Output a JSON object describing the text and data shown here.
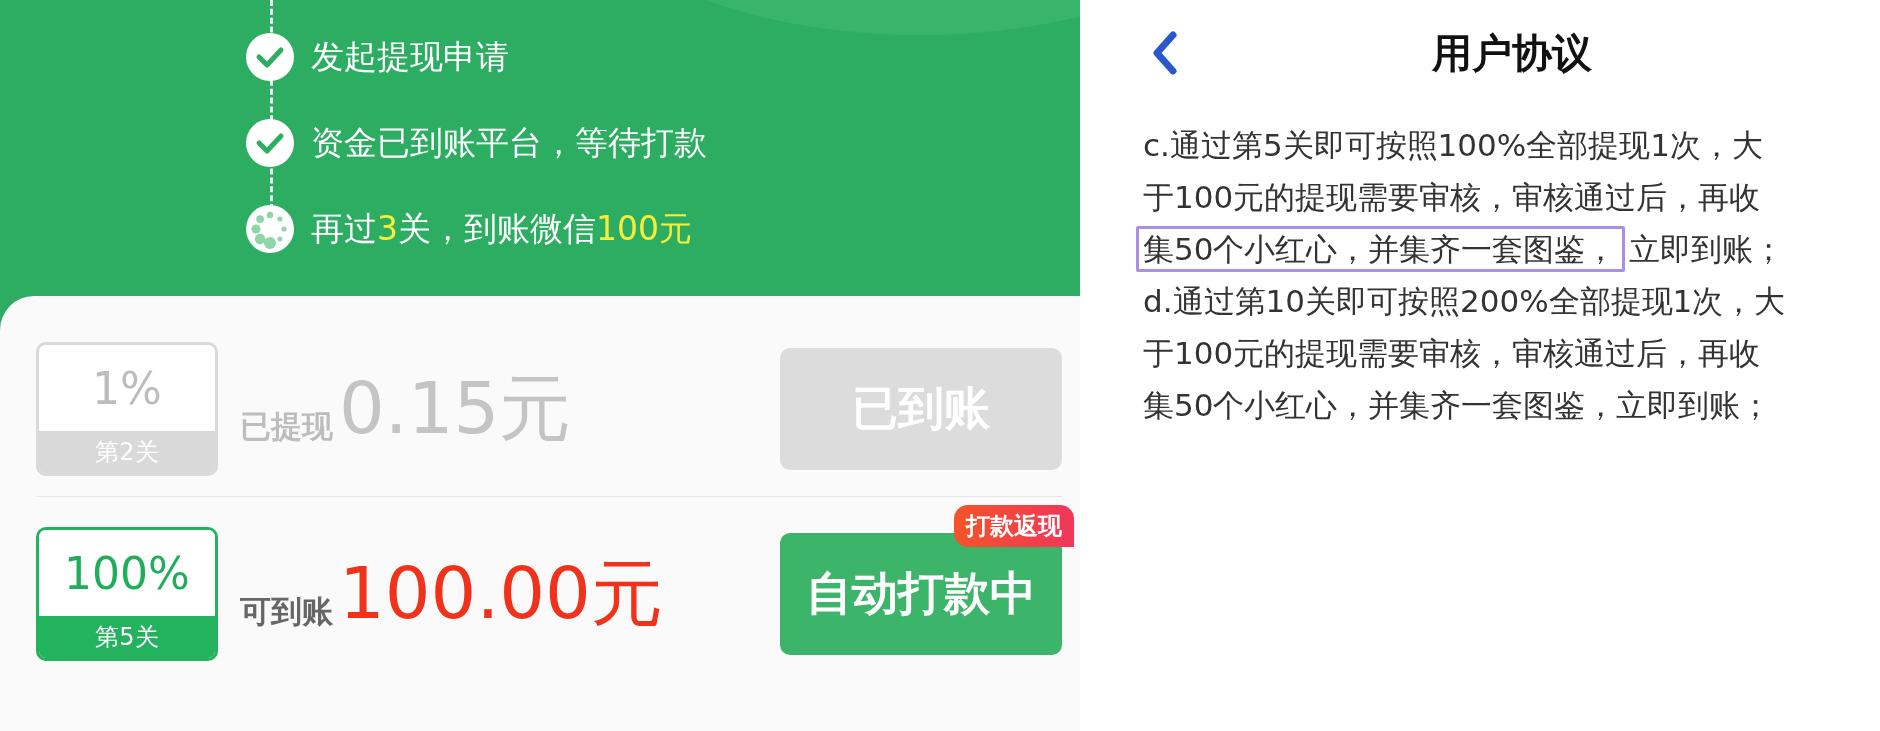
{
  "steps": [
    {
      "kind": "done",
      "segments": [
        {
          "text": "发起提现申请",
          "highlight": false
        }
      ]
    },
    {
      "kind": "done",
      "segments": [
        {
          "text": "资金已到账平台，等待打款",
          "highlight": false
        }
      ]
    },
    {
      "kind": "pending",
      "segments": [
        {
          "text": "再过",
          "highlight": false
        },
        {
          "text": "3",
          "highlight": true
        },
        {
          "text": "关，到账微信",
          "highlight": false
        },
        {
          "text": "100元",
          "highlight": true
        }
      ]
    }
  ],
  "rows": [
    {
      "kind": "withdrawn",
      "percent": "1%",
      "level_label": "第2关",
      "label": "已提现",
      "amount": "0.15元",
      "button": "已到账"
    },
    {
      "kind": "available",
      "percent": "100%",
      "level_label": "第5关",
      "label": "可到账",
      "amount": "100.00元",
      "button": "自动打款中",
      "tag": "打款返现"
    }
  ],
  "agreement": {
    "title": "用户协议",
    "lines": [
      [
        {
          "text": "c.通过第5关即可按照100%全部提现1次，大",
          "highlighted": false
        }
      ],
      [
        {
          "text": "于100元的提现需要审核，审核通过后，再收",
          "highlighted": false
        }
      ],
      [
        {
          "text": "集50个小红心，并集齐一套图鉴，",
          "highlighted": true
        },
        {
          "text": "立即到账；",
          "highlighted": false
        }
      ],
      [
        {
          "text": "d.通过第10关即可按照200%全部提现1次，大",
          "highlighted": false
        }
      ],
      [
        {
          "text": "于100元的提现需要审核，审核通过后，再收",
          "highlighted": false
        }
      ],
      [
        {
          "text": "集50个小红心，并集齐一套图鉴，立即到账；",
          "highlighted": false
        }
      ]
    ]
  }
}
